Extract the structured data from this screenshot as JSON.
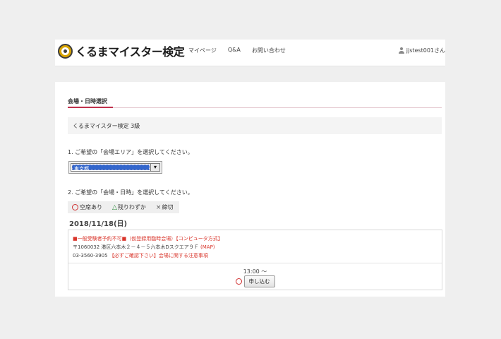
{
  "header": {
    "logo_text": "くるまマイスター検定",
    "nav": [
      "マイページ",
      "Q&A",
      "お問い合わせ"
    ],
    "user": "jjstest001さん"
  },
  "section": {
    "title": "会場・日時選択",
    "grade": "くるまマイスター検定 3級"
  },
  "step1": {
    "label": "1. ご希望の「会場エリア」を選択してください。",
    "selected": "東京都"
  },
  "step2": {
    "label": "2. ご希望の「会場・日時」を選択してください。"
  },
  "legend": {
    "available": "空席あり",
    "few": "残りわずか",
    "closed": "締切"
  },
  "date": "2018/11/18(日)",
  "venue": {
    "line1": "■一般受験者予約不可■（仮登録用臨時会場）【コンピュータ方式】",
    "address": "〒1060032 港区六本木２－４－５六本木Dスクエア９Ｆ",
    "map_link": "(MAP)",
    "phone": "03-3560-3905",
    "notice": "【必ずご確認下さい】会場に関する注意事項",
    "time": "13:00 ～",
    "apply_label": "申し込む"
  },
  "colors": {
    "accent": "#c0314c",
    "red_text": "#d9352b",
    "available_green": "#2a8a3a"
  }
}
